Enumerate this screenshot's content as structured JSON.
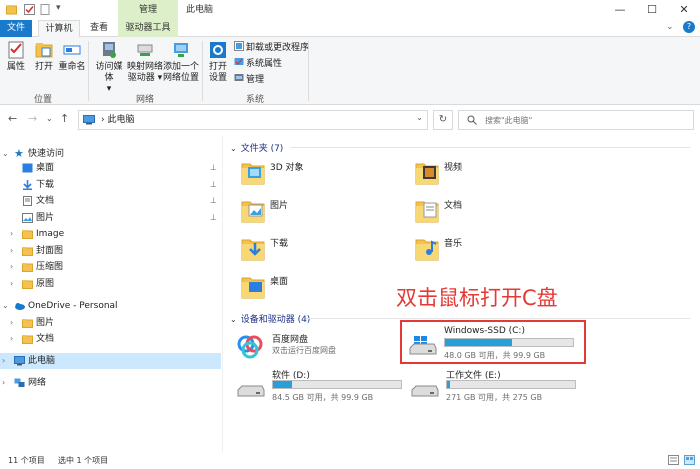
{
  "window": {
    "title": "此电脑",
    "manage_tab": "管理",
    "controls": {
      "minimize": "—",
      "maximize": "☐",
      "close": "✕"
    }
  },
  "tabs": [
    "文件",
    "计算机",
    "查看",
    "驱动器工具"
  ],
  "ribbon": {
    "location": {
      "label": "位置",
      "items": [
        "属性",
        "打开",
        "重命名"
      ]
    },
    "network": {
      "label": "网络",
      "items": [
        {
          "line1": "访问媒体",
          "line2": "▾"
        },
        {
          "line1": "映射网络",
          "line2": "驱动器 ▾"
        },
        {
          "line1": "添加一个",
          "line2": "网络位置"
        }
      ]
    },
    "system": {
      "label": "系统",
      "open_settings": {
        "line1": "打开",
        "line2": "设置"
      },
      "small": [
        "卸载或更改程序",
        "系统属性",
        "管理"
      ]
    }
  },
  "address": {
    "path": "此电脑",
    "search_placeholder": "搜索\"此电脑\""
  },
  "nav": {
    "quick_access": "快速访问",
    "quick_items": [
      "桌面",
      "下载",
      "文档",
      "图片",
      "Image",
      "封面图",
      "压缩图",
      "原图"
    ],
    "onedrive": "OneDrive - Personal",
    "onedrive_items": [
      "图片",
      "文档"
    ],
    "this_pc": "此电脑",
    "network": "网络"
  },
  "content": {
    "folders_header": "文件夹 (7)",
    "folders": [
      "3D 对象",
      "视频",
      "图片",
      "文档",
      "下载",
      "音乐",
      "桌面"
    ],
    "devices_header": "设备和驱动器 (4)",
    "baidu": {
      "name": "百度网盘",
      "sub": "双击运行百度网盘"
    },
    "drives": [
      {
        "name": "Windows-SSD (C:)",
        "size": "48.0 GB 可用，共 99.9 GB",
        "used": 0.52
      },
      {
        "name": "软件 (D:)",
        "size": "84.5 GB 可用，共 99.9 GB",
        "used": 0.15
      },
      {
        "name": "工作文件 (E:)",
        "size": "271 GB 可用，共 275 GB",
        "used": 0.02
      }
    ],
    "annotation": "双击鼠标打开C盘"
  },
  "status": {
    "count": "11 个项目",
    "selected": "选中 1 个项目"
  },
  "colors": {
    "accent": "#1979ca",
    "drive_bar": "#26a0da",
    "annotation": "#e53935"
  }
}
